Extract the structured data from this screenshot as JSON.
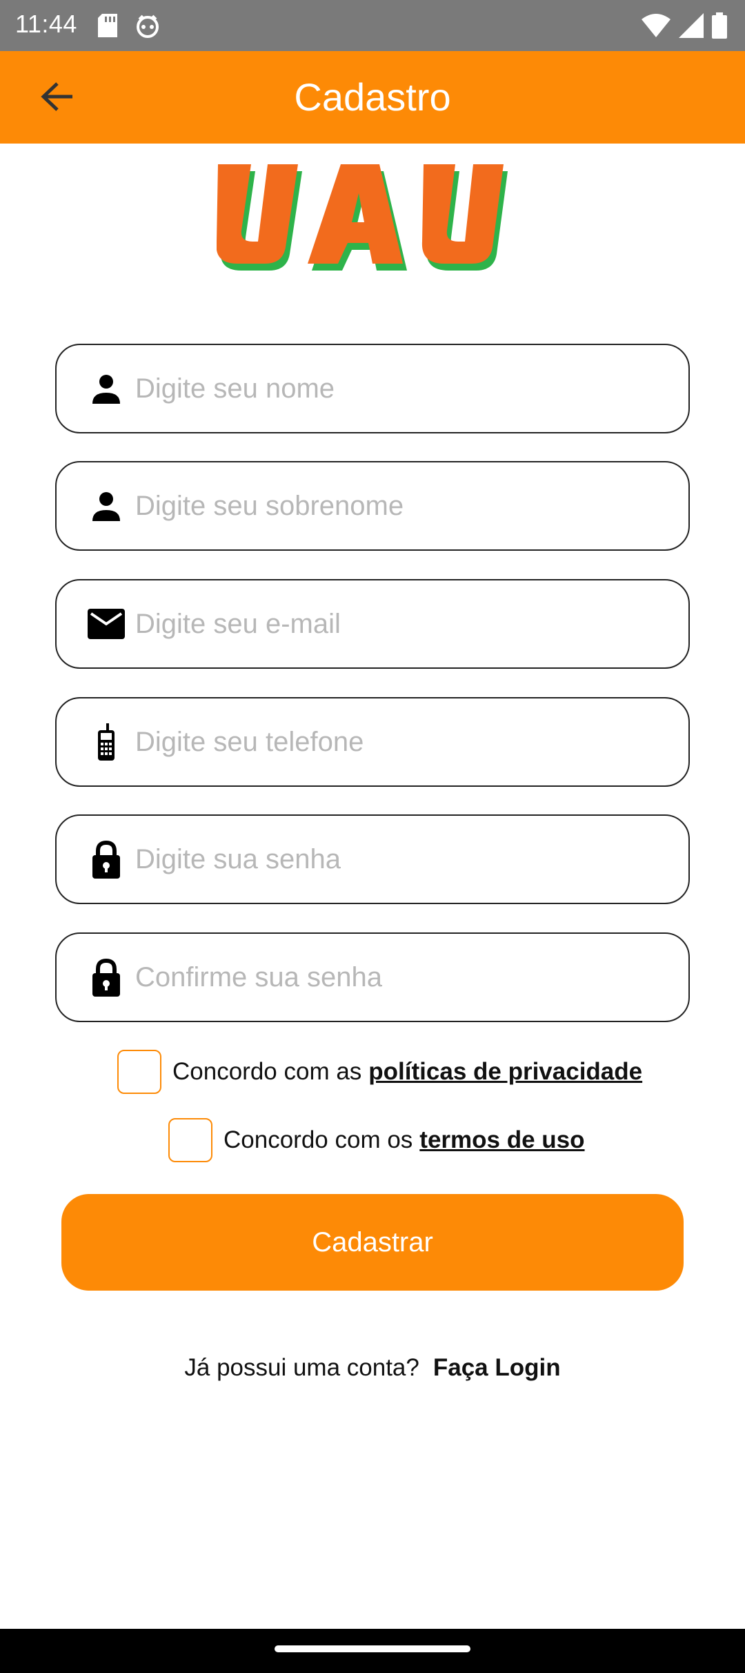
{
  "status_bar": {
    "time": "11:44",
    "icons": [
      "sd-card-icon",
      "face-notification-icon",
      "wifi-icon",
      "signal-icon",
      "battery-icon"
    ]
  },
  "app_bar": {
    "title": "Cadastro",
    "back_icon": "arrow-left-icon"
  },
  "logo": {
    "text": "UAU",
    "colors": {
      "front": "#f26b1d",
      "shadow": "#2eb34a"
    }
  },
  "form": {
    "fields": [
      {
        "placeholder": "Digite seu nome",
        "icon": "person-icon",
        "value": ""
      },
      {
        "placeholder": "Digite seu sobrenome",
        "icon": "person-icon",
        "value": ""
      },
      {
        "placeholder": "Digite seu e-mail",
        "icon": "email-icon",
        "value": ""
      },
      {
        "placeholder": "Digite seu telefone",
        "icon": "phone-icon",
        "value": ""
      },
      {
        "placeholder": "Digite sua senha",
        "icon": "lock-icon",
        "value": ""
      },
      {
        "placeholder": "Confirme sua senha",
        "icon": "lock-icon",
        "value": ""
      }
    ],
    "privacy": {
      "text": "Concordo com as",
      "link": "políticas de privacidade",
      "checked": false
    },
    "terms": {
      "text": "Concordo com os",
      "link": "termos de uso",
      "checked": false
    },
    "submit_label": "Cadastrar"
  },
  "login_prompt": {
    "text": "Já possui uma conta?",
    "link": "Faça Login"
  },
  "colors": {
    "accent": "#fd8a06",
    "status_bar": "#7a7a7a",
    "placeholder": "#b7b7b7",
    "border": "#222222"
  }
}
